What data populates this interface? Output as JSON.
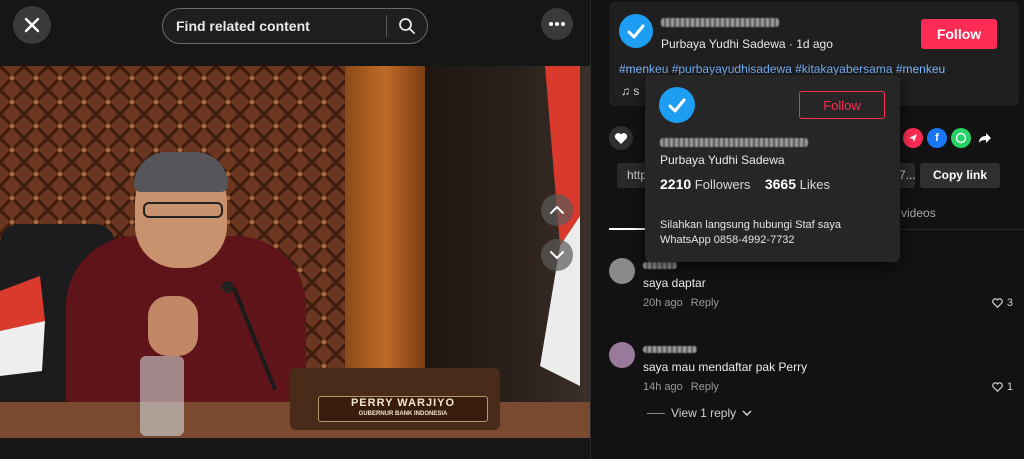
{
  "top_bar": {
    "search_placeholder": "Find related content"
  },
  "video": {
    "nameplate_name": "PERRY WARJIYO",
    "nameplate_title": "GUBERNUR BANK INDONESIA"
  },
  "author": {
    "display_line": "Purbaya Yudhi Sadewa · 1d ago",
    "follow_label": "Follow",
    "hashtags": "#menkeu #purbayayudhisadewa #kitakayabersama #menkeu",
    "music_text": "s"
  },
  "share": {
    "link_text": "http",
    "link_tail": "7...",
    "copy_label": "Copy link",
    "other_tab_label": "or videos"
  },
  "popover": {
    "follow_label": "Follow",
    "name": "Purbaya Yudhi Sadewa",
    "followers_count": "2210",
    "followers_label": "Followers",
    "likes_count": "3665",
    "likes_label": "Likes",
    "bio_line1": "Silahkan langsung hubungi Staf saya",
    "bio_line2": "WhatsApp 0858-4992-7732"
  },
  "comments": [
    {
      "text": "saya daptar",
      "time": "20h ago",
      "reply_label": "Reply",
      "likes": "3"
    },
    {
      "text": "saya mau mendaftar pak Perry",
      "time": "14h ago",
      "reply_label": "Reply",
      "likes": "1"
    }
  ],
  "view_replies_label": "View 1 reply",
  "colors": {
    "accent": "#fe2c55",
    "link": "#7ab6ff",
    "verified_blue": "#1e9ef2"
  }
}
